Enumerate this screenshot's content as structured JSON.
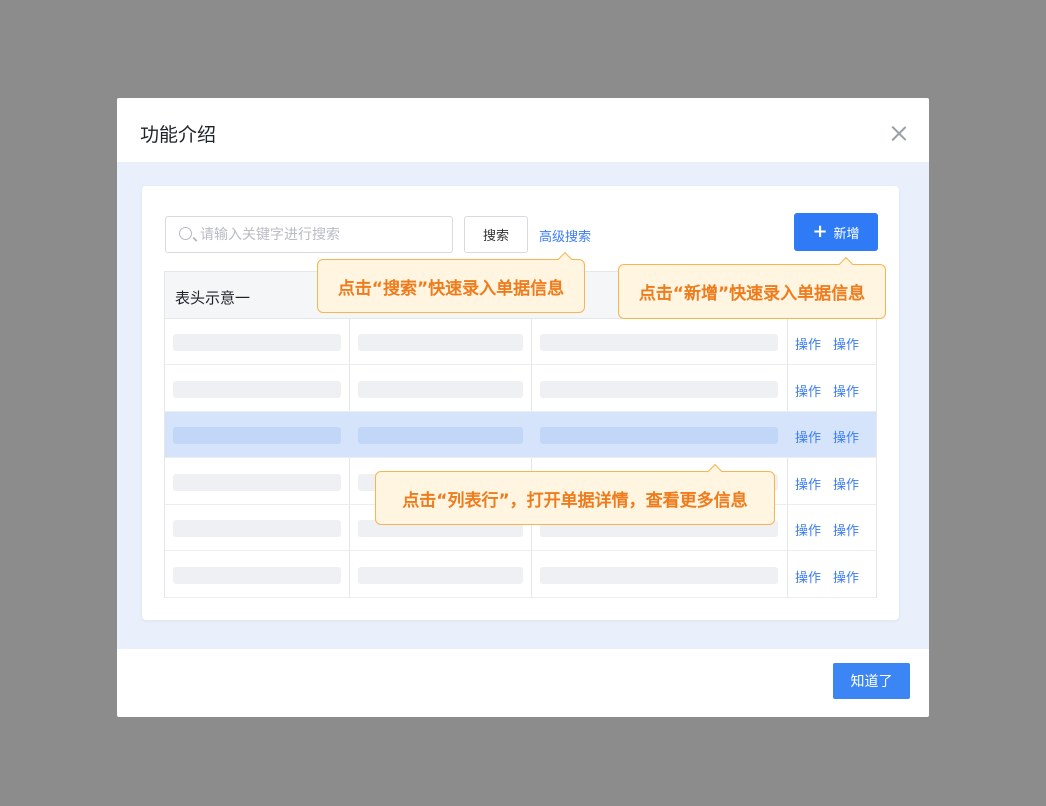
{
  "modal": {
    "title": "功能介绍"
  },
  "toolbar": {
    "search_placeholder": "请输入关键字进行搜索",
    "search_button": "搜索",
    "advanced_search": "高级搜索",
    "add_button": "新增",
    "add_icon": "plus-icon"
  },
  "table": {
    "header_title": "表头示意一",
    "rows": [
      {
        "selected": false,
        "actions": [
          "操作",
          "操作"
        ]
      },
      {
        "selected": false,
        "actions": [
          "操作",
          "操作"
        ]
      },
      {
        "selected": true,
        "actions": [
          "操作",
          "操作"
        ]
      },
      {
        "selected": false,
        "actions": [
          "操作",
          "操作"
        ]
      },
      {
        "selected": false,
        "actions": [
          "操作",
          "操作"
        ]
      },
      {
        "selected": false,
        "actions": [
          "操作",
          "操作"
        ]
      }
    ]
  },
  "callouts": {
    "search": "点击“搜索”快速录入单据信息",
    "add": "点击“新增”快速录入单据信息",
    "row": "点击“列表行”，打开单据详情，查看更多信息"
  },
  "footer": {
    "ok_button": "知道了"
  },
  "colors": {
    "primary": "#2f7bf6",
    "callout_text": "#ee7c1d",
    "callout_border": "#f7b550",
    "overlay": "#8c8c8c"
  }
}
